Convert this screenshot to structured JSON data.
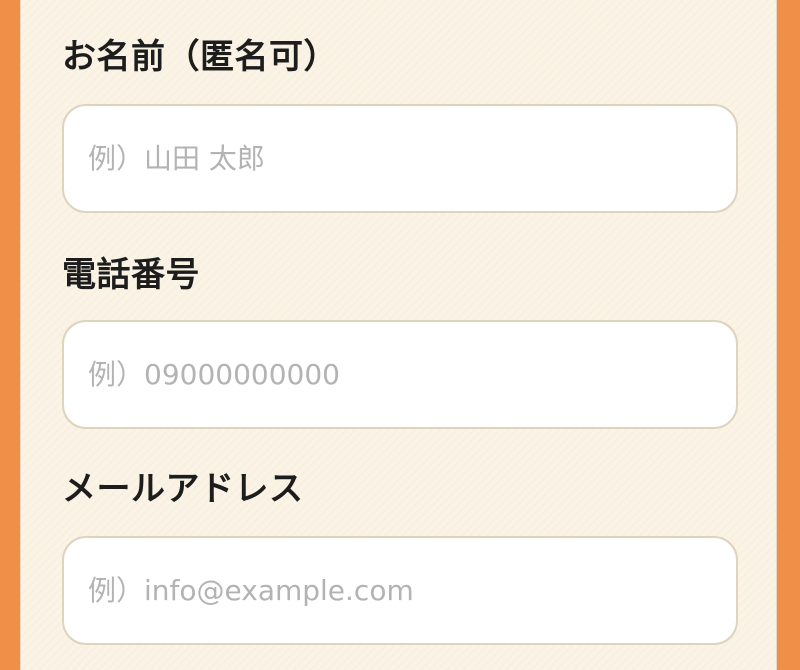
{
  "colors": {
    "page_background": "#f08f48",
    "panel_background": "#fbf4e6",
    "input_border": "#ded3bd",
    "label_text": "#1d1d1d",
    "placeholder_text": "#b3b3b3"
  },
  "form": {
    "name": {
      "label": "お名前（匿名可）",
      "value": "",
      "placeholder": "例）山田 太郎"
    },
    "phone": {
      "label": "電話番号",
      "value": "",
      "placeholder": "例）09000000000"
    },
    "email": {
      "label": "メールアドレス",
      "value": "",
      "placeholder": "例）info@example.com"
    }
  }
}
